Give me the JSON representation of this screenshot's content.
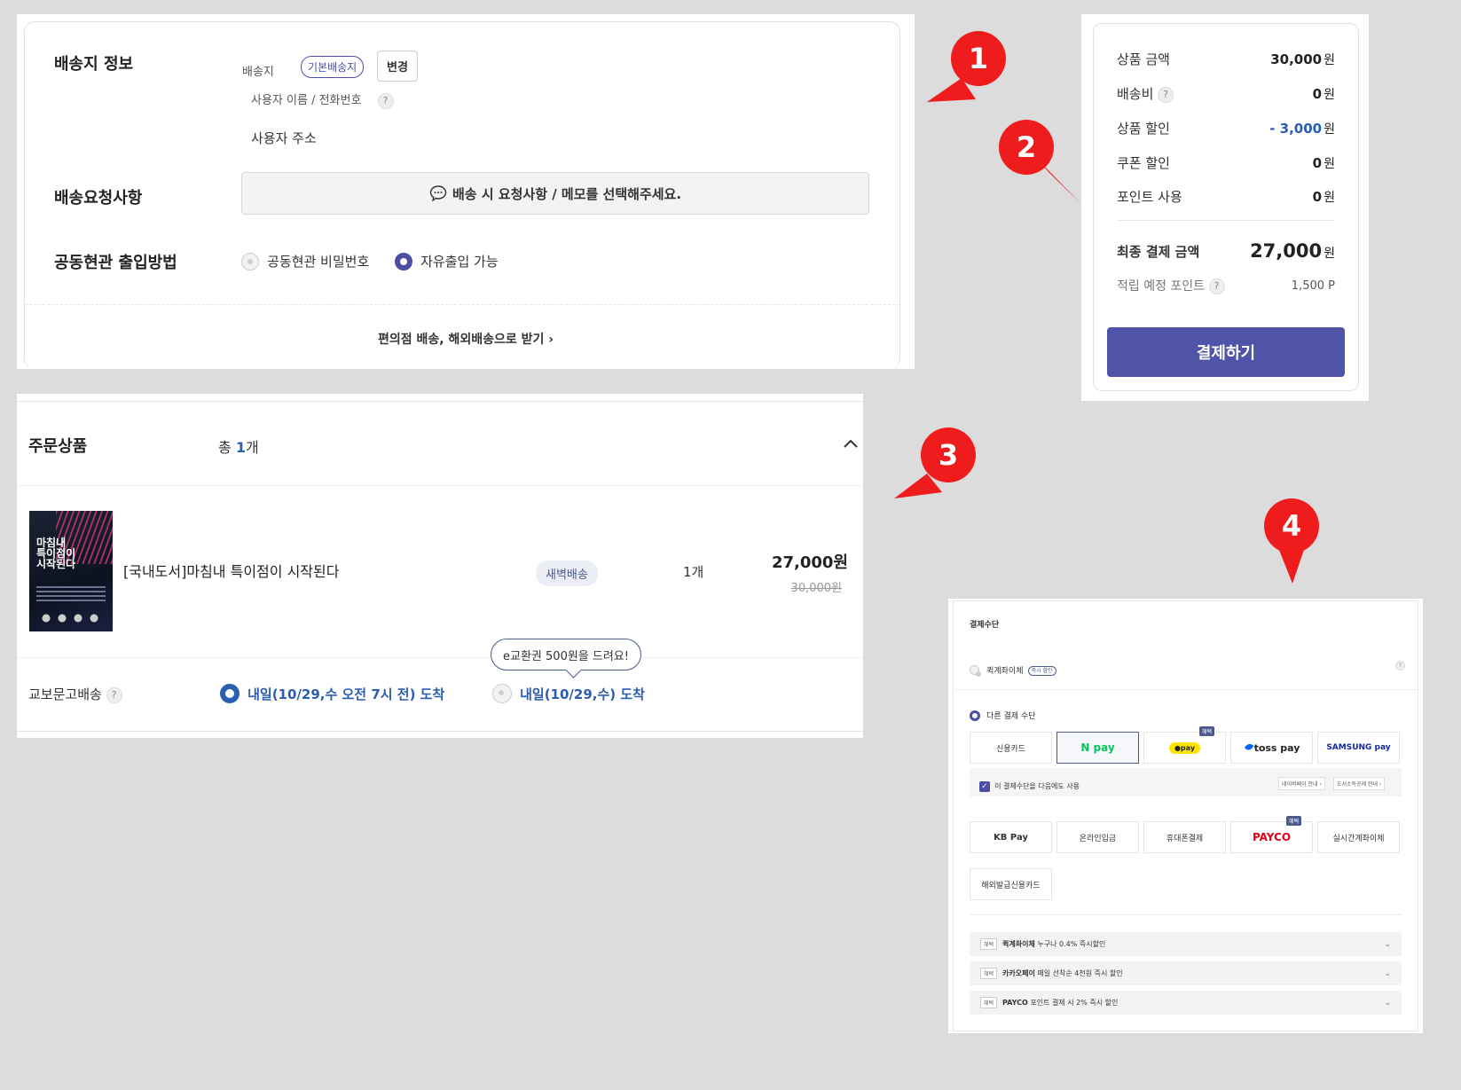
{
  "shipping": {
    "title": "배송지 정보",
    "address_label": "배송지",
    "default_chip": "기본배송지",
    "change_button": "변경",
    "user_name_phone": "사용자 이름 / 전화번호",
    "help_icon": "?",
    "user_address": "사용자 주소",
    "request_title": "배송요청사항",
    "memo_button": "배송 시 요청사항 / 메모를 선택해주세요.",
    "entrance_title": "공동현관 출입방법",
    "entrance_options": [
      {
        "label": "공동현관 비밀번호",
        "selected": false
      },
      {
        "label": "자유출입 가능",
        "selected": true
      }
    ],
    "alt_delivery_link": "편의점 배송, 해외배송으로 받기 ›"
  },
  "summary": {
    "rows": [
      {
        "label": "상품 금액",
        "value": "30,000",
        "unit": "원"
      },
      {
        "label": "배송비",
        "value": "0",
        "unit": "원",
        "help": "?"
      },
      {
        "label": "상품 할인",
        "value": "- 3,000",
        "unit": "원"
      },
      {
        "label": "쿠폰 할인",
        "value": "0",
        "unit": "원"
      },
      {
        "label": "포인트 사용",
        "value": "0",
        "unit": "원"
      }
    ],
    "final_label": "최종 결제 금액",
    "final_value": "27,000",
    "final_unit": "원",
    "points_label": "적립 예정 포인트",
    "points_help": "?",
    "points_value": "1,500 P",
    "pay_button": "결제하기",
    "accent_color": "#5054a8",
    "discount_color": "#2b5db0"
  },
  "order": {
    "title": "주문상품",
    "count_prefix": "총",
    "count_value": "1",
    "count_suffix": "개",
    "collapse_icon": "^",
    "product_name": "[국내도서]마침내 특이점이 시작된다",
    "cover_title": "마침내\n특이점이\n시작된다",
    "delivery_badge": "새벽배송",
    "quantity": "1개",
    "price": "27,000원",
    "original_price": "30,000원",
    "tooltip": "e교환권 500원을 드려요!",
    "delivery_label": "교보문고배송",
    "delivery_help": "?",
    "delivery_options": [
      {
        "label": "내일(10/29,수 오전 7시 전) 도착",
        "selected": true
      },
      {
        "label": "내일(10/29,수) 도착",
        "selected": false
      }
    ]
  },
  "payment": {
    "title": "결제수단",
    "quick_transfer": "퀵계좌이체",
    "quick_chip": "즉시 할인",
    "help": "?",
    "other_methods": "다른 결제 수단",
    "methods_row1": [
      "신용카드",
      "N pay",
      "●pay",
      "toss pay",
      "SAMSUNG pay"
    ],
    "benefit_tag": "혜택",
    "reuse_checkbox": "이 결제수단을 다음에도 사용",
    "naverpay_guide": "네이버페이 안내 ›",
    "culture_deduction": "도서소득공제 안내 ›",
    "methods_row2": [
      "KB Pay",
      "온라인입금",
      "휴대폰결제",
      "PAYCO",
      "실시간계좌이체"
    ],
    "methods_row3": [
      "해외발급신용카드"
    ],
    "benefits": [
      {
        "tag": "혜택",
        "name": "퀵계좌이체",
        "desc": "누구나 0.4% 즉시할인"
      },
      {
        "tag": "혜택",
        "name": "카카오페이",
        "desc": "매일 선착순 4천원 즉시 할인"
      },
      {
        "tag": "혜택",
        "name": "PAYCO",
        "desc": "포인트 결제 시 2% 즉시 할인"
      }
    ],
    "chevron": "⌄"
  },
  "markers": [
    "1",
    "2",
    "3",
    "4"
  ]
}
